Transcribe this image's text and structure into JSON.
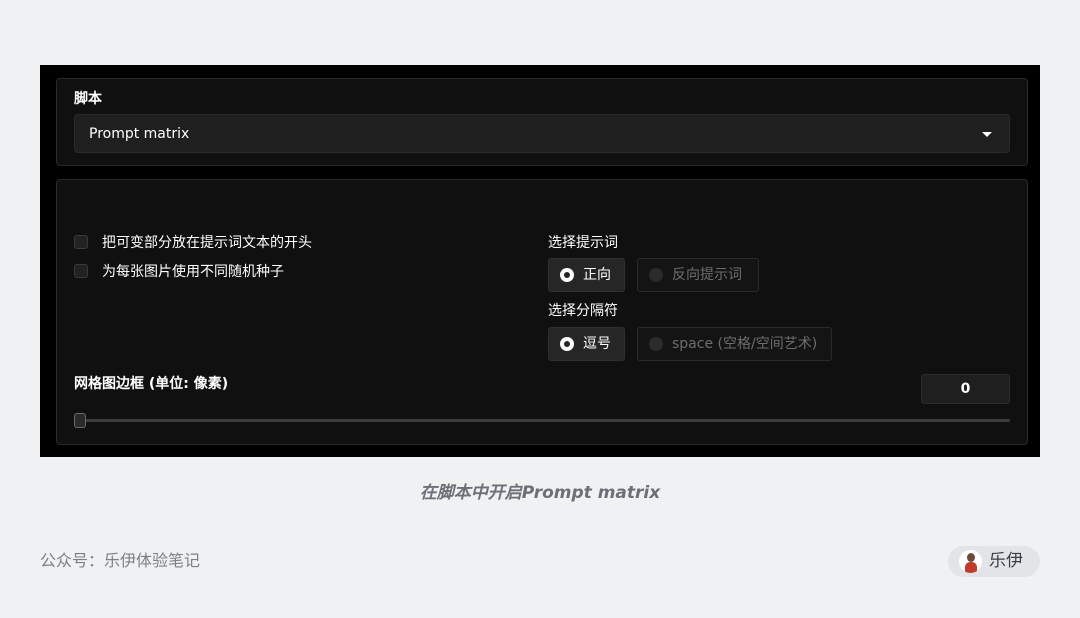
{
  "script_panel": {
    "label": "脚本",
    "dropdown_value": "Prompt matrix"
  },
  "options": {
    "checkboxes": [
      {
        "label": "把可变部分放在提示词文本的开头",
        "checked": false
      },
      {
        "label": "为每张图片使用不同随机种子",
        "checked": false
      }
    ],
    "prompt_select": {
      "label": "选择提示词",
      "options": [
        "正向",
        "反向提示词"
      ],
      "selected": "正向"
    },
    "delimiter_select": {
      "label": "选择分隔符",
      "options": [
        "逗号",
        "space (空格/空间艺术)"
      ],
      "selected": "逗号"
    },
    "grid_border": {
      "label": "网格图边框 (单位: 像素)",
      "value": "0"
    }
  },
  "caption": "在脚本中开启Prompt matrix",
  "footer": {
    "account": "公众号：乐伊体验笔记",
    "author": "乐伊"
  },
  "colors": {
    "page_bg": "#f0f1f3",
    "screen_bg": "#000000",
    "panel_bg": "#101010",
    "accent_text": "#ffffff"
  }
}
